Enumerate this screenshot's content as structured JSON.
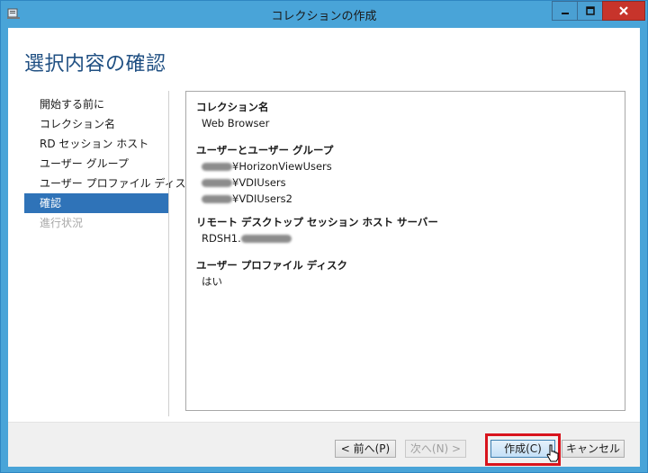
{
  "window": {
    "title": "コレクションの作成"
  },
  "page": {
    "title": "選択内容の確認"
  },
  "nav": {
    "items": [
      {
        "label": "開始する前に",
        "state": "normal"
      },
      {
        "label": "コレクション名",
        "state": "normal"
      },
      {
        "label": "RD セッション ホスト",
        "state": "normal"
      },
      {
        "label": "ユーザー グループ",
        "state": "normal"
      },
      {
        "label": "ユーザー プロファイル ディスク",
        "state": "normal"
      },
      {
        "label": "確認",
        "state": "selected"
      },
      {
        "label": "進行状況",
        "state": "disabled"
      }
    ]
  },
  "summary": {
    "collection": {
      "heading": "コレクション名",
      "value": "Web Browser"
    },
    "groups": {
      "heading": "ユーザーとユーザー グループ",
      "values": [
        "¥HorizonViewUsers",
        "¥VDIUsers",
        "¥VDIUsers2"
      ]
    },
    "hosts": {
      "heading": "リモート デスクトップ セッション ホスト サーバー",
      "value": "RDSH1."
    },
    "profile": {
      "heading": "ユーザー プロファイル ディスク",
      "value": "はい"
    }
  },
  "footer": {
    "prev_label": "< 前へ(P)",
    "next_label": "次へ(N) >",
    "create_label": "作成(C)",
    "cancel_label": "キャンセル"
  },
  "colors": {
    "accent": "#2f73b8",
    "highlight": "#d8141d",
    "chrome": "#49a4d8",
    "close": "#c7342b"
  }
}
